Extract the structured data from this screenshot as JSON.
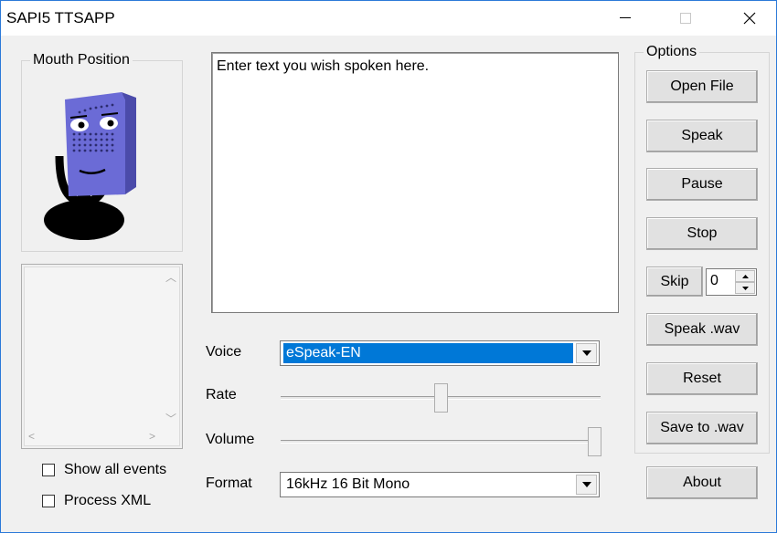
{
  "window": {
    "title": "SAPI5 TTSAPP",
    "minimize_glyph": "—",
    "maximize_glyph": "☐",
    "close_glyph": "✕"
  },
  "mouth_group": {
    "label": "Mouth Position",
    "image": "microphone-character"
  },
  "events_list": {
    "items": []
  },
  "checkboxes": {
    "show_all_events": {
      "label": "Show all events",
      "checked": false
    },
    "process_xml": {
      "label": "Process XML",
      "checked": false
    }
  },
  "text_input": {
    "value": "Enter text you wish spoken here."
  },
  "voice": {
    "label": "Voice",
    "selected": "eSpeak-EN"
  },
  "rate": {
    "label": "Rate",
    "level_fraction": 0.5
  },
  "volume": {
    "label": "Volume",
    "level_fraction": 1.0
  },
  "format": {
    "label": "Format",
    "selected": "16kHz 16 Bit Mono"
  },
  "options": {
    "label": "Options",
    "open_file": "Open File",
    "speak": "Speak",
    "pause": "Pause",
    "stop": "Stop",
    "skip": "Skip",
    "skip_value": "0",
    "speak_wav": "Speak .wav",
    "reset": "Reset",
    "save_wav": "Save to .wav"
  },
  "about": "About",
  "colors": {
    "accent": "#0078d7",
    "mic_body": "#6b6bd6",
    "mic_dark": "#000000"
  }
}
